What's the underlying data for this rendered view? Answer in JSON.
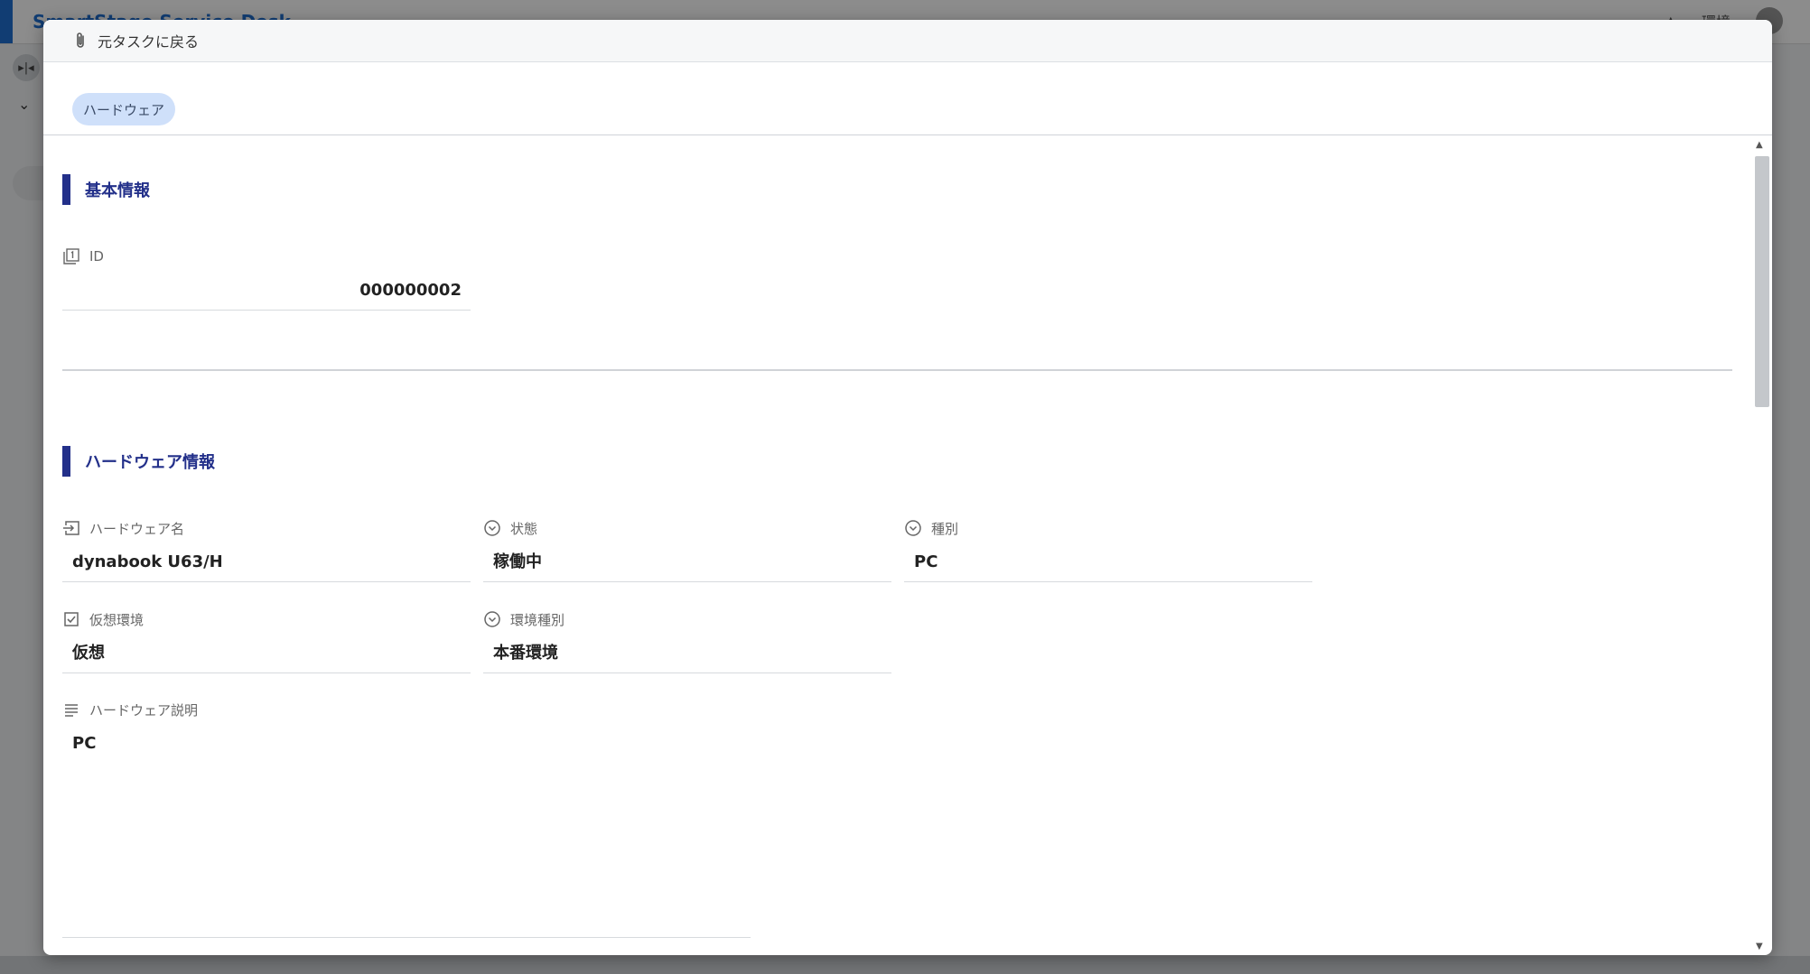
{
  "background": {
    "app_title": "SmartStage Service Desk",
    "env_label": "環境"
  },
  "modal": {
    "back_label": "元タスクに戻る",
    "tab_chip": "ハードウェア",
    "sections": {
      "basic": {
        "title": "基本情報",
        "id_label": "ID",
        "id_value": "000000002"
      },
      "hardware": {
        "title": "ハードウェア情報",
        "name_label": "ハードウェア名",
        "name_value": "dynabook U63/H",
        "status_label": "状態",
        "status_value": "稼働中",
        "type_label": "種別",
        "type_value": "PC",
        "virtual_label": "仮想環境",
        "virtual_value": "仮想",
        "env_type_label": "環境種別",
        "env_type_value": "本番環境",
        "desc_label": "ハードウェア説明",
        "desc_value": "PC"
      }
    }
  },
  "colors": {
    "accent": "#1f6fd1",
    "section_bar": "#23308a",
    "chip_bg": "#cfe0fa"
  },
  "icons": {
    "back": "paperclip-icon",
    "id": "id-card-icon",
    "name": "login-arrow-icon",
    "status": "circle-chevron-down-icon",
    "type": "circle-chevron-down-icon",
    "virtual": "checkbox-icon",
    "env_type": "circle-chevron-down-icon",
    "desc": "text-lines-icon"
  }
}
